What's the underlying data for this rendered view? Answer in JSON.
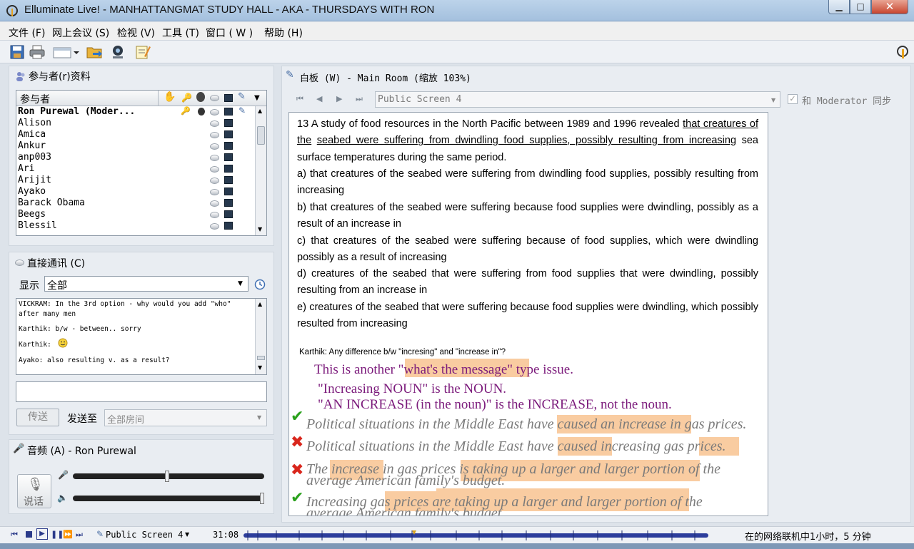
{
  "window": {
    "title": "Elluminate Live! - MANHATTANGMAT STUDY HALL - AKA - THURSDAYS WITH RON",
    "min_glyph": "▁",
    "max_glyph": "□",
    "close_glyph": "✕"
  },
  "menu": [
    "文件 (F)",
    "网上会议 (S)",
    "检视 (V)",
    "工具 (T)",
    "窗口 ( W )",
    "帮助 (H)"
  ],
  "participants": {
    "title": "参与者(r)资料",
    "header": "参与者",
    "list": [
      {
        "name": "Ron Purewal (Moder...",
        "moderator": true
      },
      {
        "name": "Alison"
      },
      {
        "name": "Amica"
      },
      {
        "name": "Ankur"
      },
      {
        "name": "anp003"
      },
      {
        "name": "Ari"
      },
      {
        "name": "Arijit"
      },
      {
        "name": "Ayako"
      },
      {
        "name": "Barack Obama"
      },
      {
        "name": "Beegs"
      },
      {
        "name": "Blessil"
      }
    ]
  },
  "chat": {
    "title": "直接通讯 (C)",
    "show_label": "显示",
    "show_value": "全部",
    "messages": [
      "VICKRAM: In the 3rd option - why would you add \"who\"",
      "after many men",
      "Karthik: b/w - between.. sorry",
      "Karthik:",
      "Ayako: also resulting v. as a result?"
    ],
    "send_button": "传送",
    "send_to_label": "发送至",
    "send_to_value": "全部房间"
  },
  "audio": {
    "title": "音频 (A) - Ron Purewal",
    "talk_button": "说话"
  },
  "whiteboard": {
    "title": "白板 (W) - Main Room (缩放 103%)",
    "screen_select": "Public Screen 4",
    "sync_label": "和 Moderator 同步",
    "sync_checked": true,
    "question_lead": "13 A study of food resources in the North Pacific between 1989 and 1996 revealed ",
    "question_underlined_1": "that creatures of the",
    "question_underlined_2": "seabed were suffering from dwindling food supplies, possibly resulting from increasing",
    "question_tail_1": " sea surface",
    "question_tail_2": "temperatures during the same period.",
    "options": [
      "a) that creatures of the seabed were suffering from dwindling food supplies, possibly resulting from increasing",
      "b) that creatures of the seabed were suffering because food supplies were dwindling, possibly as a result of an increase in",
      "c) that creatures of the seabed were suffering because of food supplies, which were dwindling possibly as a result of increasing",
      "d) creatures of the seabed that were suffering from food supplies that were dwindling, possibly resulting from an increase in",
      "e) creatures of the seabed that were suffering because food supplies were dwindling, which possibly resulted from increasing"
    ],
    "chat_note": "Karthik: Any difference b/w \"incresing\" and \"increase in\"?",
    "note_1": "This is another \"what's the message\" type issue.",
    "note_2": "\"Increasing NOUN\" is the NOUN.",
    "note_3": "\"AN INCREASE (in the noun)\" is the INCREASE, not the noun.",
    "example_1": "Political situations in the Middle East have caused an increase in gas prices.",
    "example_2": "Political situations in the Middle East have caused increasing gas prices.",
    "example_3a": "The increase in gas prices is taking up a larger and larger portion of the",
    "example_3b": "average American family's budget.",
    "example_4a": "Increasing gas prices are taking up a larger and larger portion of  the",
    "example_4b": "average American family's budget."
  },
  "status": {
    "screen": "Public Screen 4",
    "time": "31:08",
    "online": "在的网络联机中1小时，5 分钟"
  },
  "colors": {
    "note_purple": "#7b1a7b",
    "highlight": "#f8c391",
    "check_green": "#2aa11c",
    "cross_red": "#d9261c",
    "timeline_blue": "#2c3d9c"
  }
}
